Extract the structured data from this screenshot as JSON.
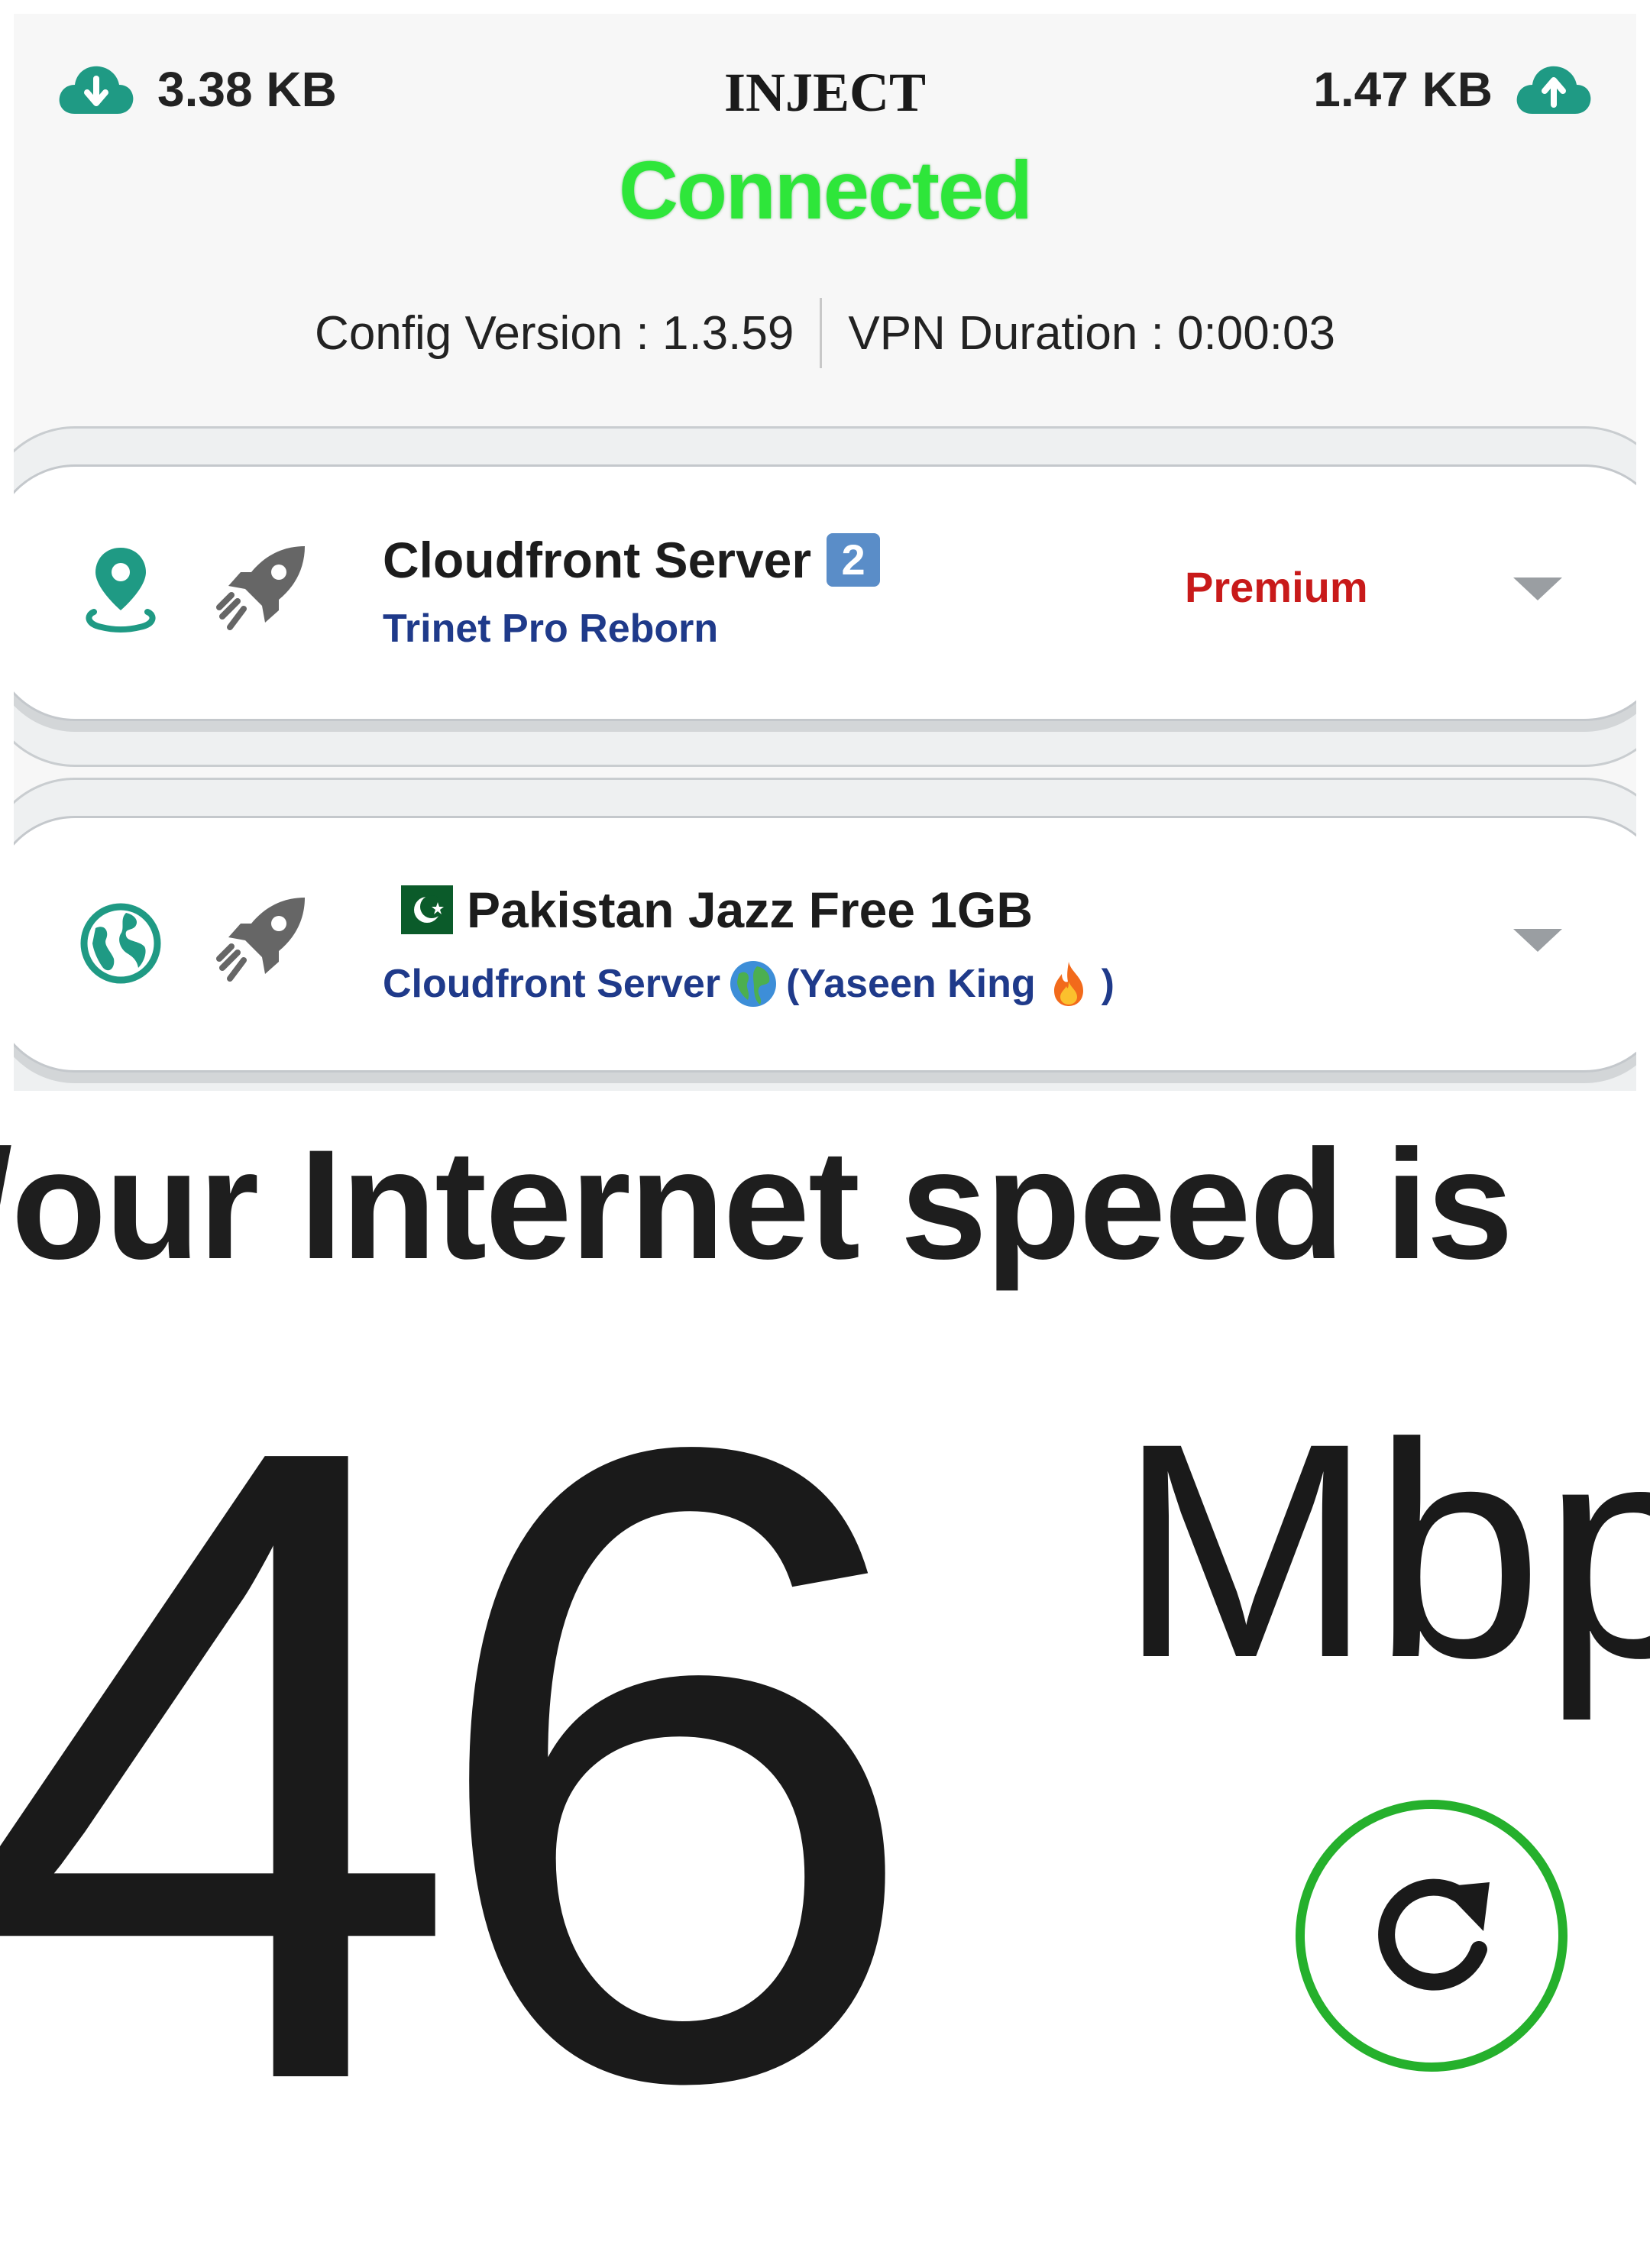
{
  "header": {
    "download": {
      "value": "3.38 KB",
      "icon": "cloud-download-icon"
    },
    "title": "INJECT",
    "upload": {
      "value": "1.47 KB",
      "icon": "cloud-upload-icon"
    },
    "status": "Connected",
    "status_color": "#2ee63a",
    "config_version": "Config Version : 1.3.59",
    "vpn_duration": "VPN Duration : 0:00:03"
  },
  "servers": [
    {
      "title": "Cloudfront Server",
      "title_badge": "2",
      "subtitle": "Trinet Pro Reborn",
      "tier": "Premium",
      "icon": "location-pin-icon",
      "rocket_icon": "rocket-icon"
    },
    {
      "flag": "pakistan-flag",
      "title": "Pakistan Jazz Free 1GB",
      "subtitle_part1": "Cloudfront Server",
      "subtitle_part2": "(Yaseen King",
      "subtitle_part3": ")",
      "icon": "globe-icon",
      "rocket_icon": "rocket-icon"
    }
  ],
  "speed": {
    "heading": "/our Internet speed is",
    "value": "46",
    "unit": "Mbp",
    "refresh_icon": "refresh-icon",
    "accent": "#25b02c"
  }
}
